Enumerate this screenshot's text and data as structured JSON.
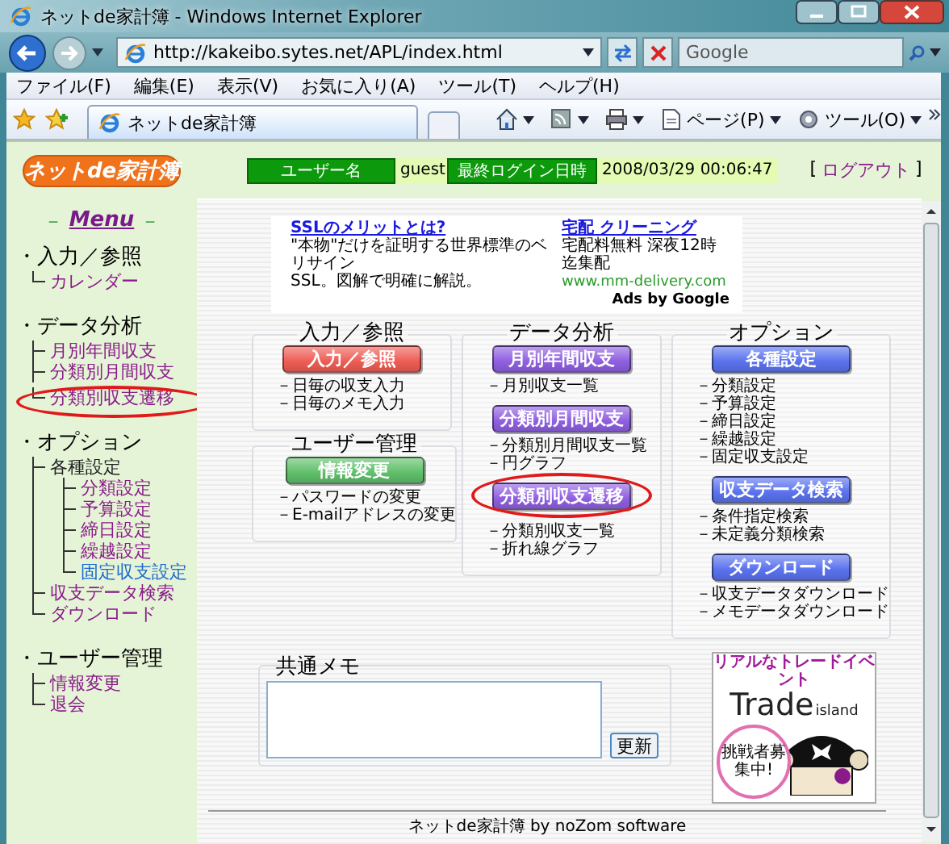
{
  "window": {
    "title": "ネットde家計簿 - Windows Internet Explorer"
  },
  "address_bar": {
    "url": "http://kakeibo.sytes.net/APL/index.html"
  },
  "search": {
    "placeholder": "Google"
  },
  "menu_bar": [
    "ファイル(F)",
    "編集(E)",
    "表示(V)",
    "お気に入り(A)",
    "ツール(T)",
    "ヘルプ(H)"
  ],
  "tabs": [
    {
      "label": "ネットde家計簿",
      "selected": true
    }
  ],
  "command_bar": [
    {
      "kind": "home"
    },
    {
      "kind": "feed"
    },
    {
      "kind": "print"
    },
    {
      "kind": "page",
      "label": "ページ(P)"
    },
    {
      "kind": "tools",
      "label": "ツール(O)"
    }
  ],
  "header": {
    "logo": "ネットde家計簿",
    "user_label": "ユーザー名",
    "user": "guest",
    "login_label": "最終ログイン日時",
    "login_time": "2008/03/29 00:06:47",
    "logout": {
      "before": "[",
      "label": "ログアウト",
      "after": "]"
    }
  },
  "sidebar": {
    "title": {
      "before": "－",
      "label": "Menu",
      "after": "－"
    },
    "sections": [
      {
        "label": "・入力／参照",
        "children": [
          {
            "label": "カレンダー",
            "kind": "link",
            "visited": true
          }
        ]
      },
      {
        "label": "・データ分析",
        "children": [
          {
            "label": "月別年間収支",
            "kind": "link",
            "visited": true
          },
          {
            "label": "分類別月間収支",
            "kind": "link",
            "visited": true
          },
          {
            "label": "分類別収支遷移",
            "kind": "link",
            "visited": true,
            "circled": true
          }
        ]
      },
      {
        "label": "・オプション",
        "children": [
          {
            "label": "各種設定",
            "kind": "label",
            "children": [
              {
                "label": "分類設定",
                "kind": "link",
                "visited": true
              },
              {
                "label": "予算設定",
                "kind": "link",
                "visited": true
              },
              {
                "label": "締日設定",
                "kind": "link",
                "visited": true
              },
              {
                "label": "繰越設定",
                "kind": "link",
                "visited": true
              },
              {
                "label": "固定収支設定",
                "kind": "link",
                "visited": false
              }
            ]
          },
          {
            "label": "収支データ検索",
            "kind": "link",
            "visited": true
          },
          {
            "label": "ダウンロード",
            "kind": "link",
            "visited": true
          }
        ]
      },
      {
        "label": "・ユーザー管理",
        "children": [
          {
            "label": "情報変更",
            "kind": "link",
            "visited": true
          },
          {
            "label": "退会",
            "kind": "link",
            "visited": true
          }
        ]
      }
    ]
  },
  "ads": {
    "items": [
      {
        "title": "SSLのメリットとは?",
        "lines": [
          "\"本物\"だけを証明する世界標準のベリサイン",
          "SSL。図解で明確に解説。"
        ]
      },
      {
        "title": "宅配 クリーニング",
        "lines": [
          "宅配料無料 深夜12時迄集配"
        ],
        "url": "www.mm-delivery.com"
      }
    ],
    "attribution": "Ads by Google"
  },
  "columns": [
    [
      {
        "title": "入力／参照",
        "groups": [
          {
            "button": {
              "label": "入力／参照",
              "color": "#ee5c54"
            },
            "items": [
              "－日毎の収支入力",
              "－日毎のメモ入力"
            ]
          }
        ]
      },
      {
        "title": "ユーザー管理",
        "groups": [
          {
            "button": {
              "label": "情報変更",
              "color": "#5fbf6a"
            },
            "items": [
              "－パスワードの変更",
              "－E-mailアドレスの変更"
            ]
          }
        ]
      }
    ],
    [
      {
        "title": "データ分析",
        "groups": [
          {
            "button": {
              "label": "月別年間収支",
              "color": "#8f5fe0"
            },
            "items": [
              "－月別収支一覧"
            ]
          },
          {
            "button": {
              "label": "分類別月間収支",
              "color": "#8f5fe0"
            },
            "items": [
              "－分類別月間収支一覧",
              "－円グラフ"
            ]
          },
          {
            "button": {
              "label": "分類別収支遷移",
              "color": "#8f5fe0",
              "circled": true
            },
            "items": [
              "－分類別収支一覧",
              "－折れ線グラフ"
            ]
          }
        ]
      }
    ],
    [
      {
        "title": "オプション",
        "groups": [
          {
            "button": {
              "label": "各種設定",
              "color": "#5a72ee"
            },
            "items": [
              "－分類設定",
              "－予算設定",
              "－締日設定",
              "－繰越設定",
              "－固定収支設定"
            ]
          },
          {
            "button": {
              "label": "収支データ検索",
              "color": "#5a72ee"
            },
            "items": [
              "－条件指定検索",
              "－未定義分類検索"
            ]
          },
          {
            "button": {
              "label": "ダウンロード",
              "color": "#5a72ee"
            },
            "items": [
              "－収支データダウンロード",
              "－メモデータダウンロード"
            ]
          }
        ]
      }
    ]
  ],
  "memo": {
    "title": "共通メモ",
    "button": "更新"
  },
  "banner": {
    "headline": "リアルなトレードイベント",
    "brand": "Trade",
    "brand_suffix": "island",
    "badge": "挑戦者募集中!"
  },
  "footer": "ネットde家計簿 by noZom software"
}
